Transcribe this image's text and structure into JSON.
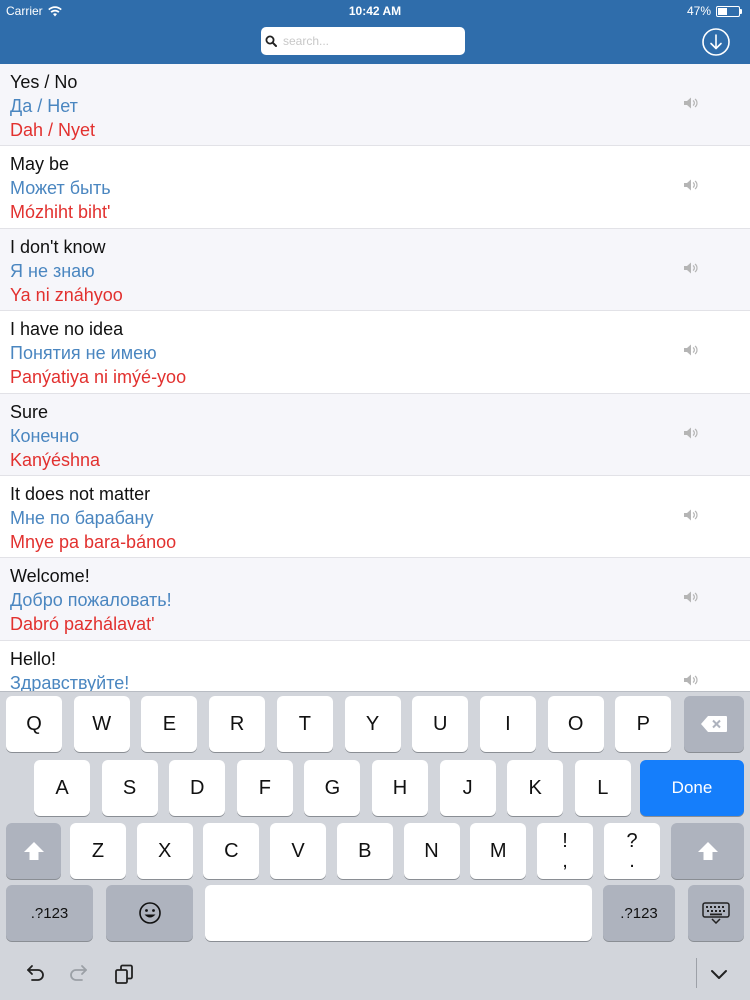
{
  "status": {
    "carrier": "Carrier",
    "time": "10:42 AM",
    "battery": "47%",
    "battery_level": 0.47
  },
  "search": {
    "placeholder": "search..."
  },
  "phrases": [
    {
      "en": "Yes / No",
      "ru": "Да / Нет",
      "tr": "Dah / Nyet"
    },
    {
      "en": "May be",
      "ru": "Может быть",
      "tr": "Mózhiht biht'"
    },
    {
      "en": "I don't know",
      "ru": "Я не знаю",
      "tr": "Ya ni znáhyoo"
    },
    {
      "en": "I have no idea",
      "ru": "Понятия не имею",
      "tr": "Panýatiya ni imýé-yoo"
    },
    {
      "en": "Sure",
      "ru": "Конечно",
      "tr": "Kanýéshna"
    },
    {
      "en": "It does not matter",
      "ru": "Мне по барабану",
      "tr": "Mnye pa bara-bánoo"
    },
    {
      "en": "Welcome!",
      "ru": "Добро пожаловать!",
      "tr": "Dabró pazhálavat'"
    },
    {
      "en": "Hello!",
      "ru": "Здравствуйте!",
      "tr": ""
    }
  ],
  "keyboard": {
    "row1": [
      "Q",
      "W",
      "E",
      "R",
      "T",
      "Y",
      "U",
      "I",
      "O",
      "P"
    ],
    "row2": [
      "A",
      "S",
      "D",
      "F",
      "G",
      "H",
      "J",
      "K",
      "L"
    ],
    "row3": [
      "Z",
      "X",
      "C",
      "V",
      "B",
      "N",
      "M"
    ],
    "punct1": [
      "!",
      ","
    ],
    "punct2": [
      "?",
      "."
    ],
    "done": "Done",
    "numbers": ".?123"
  }
}
